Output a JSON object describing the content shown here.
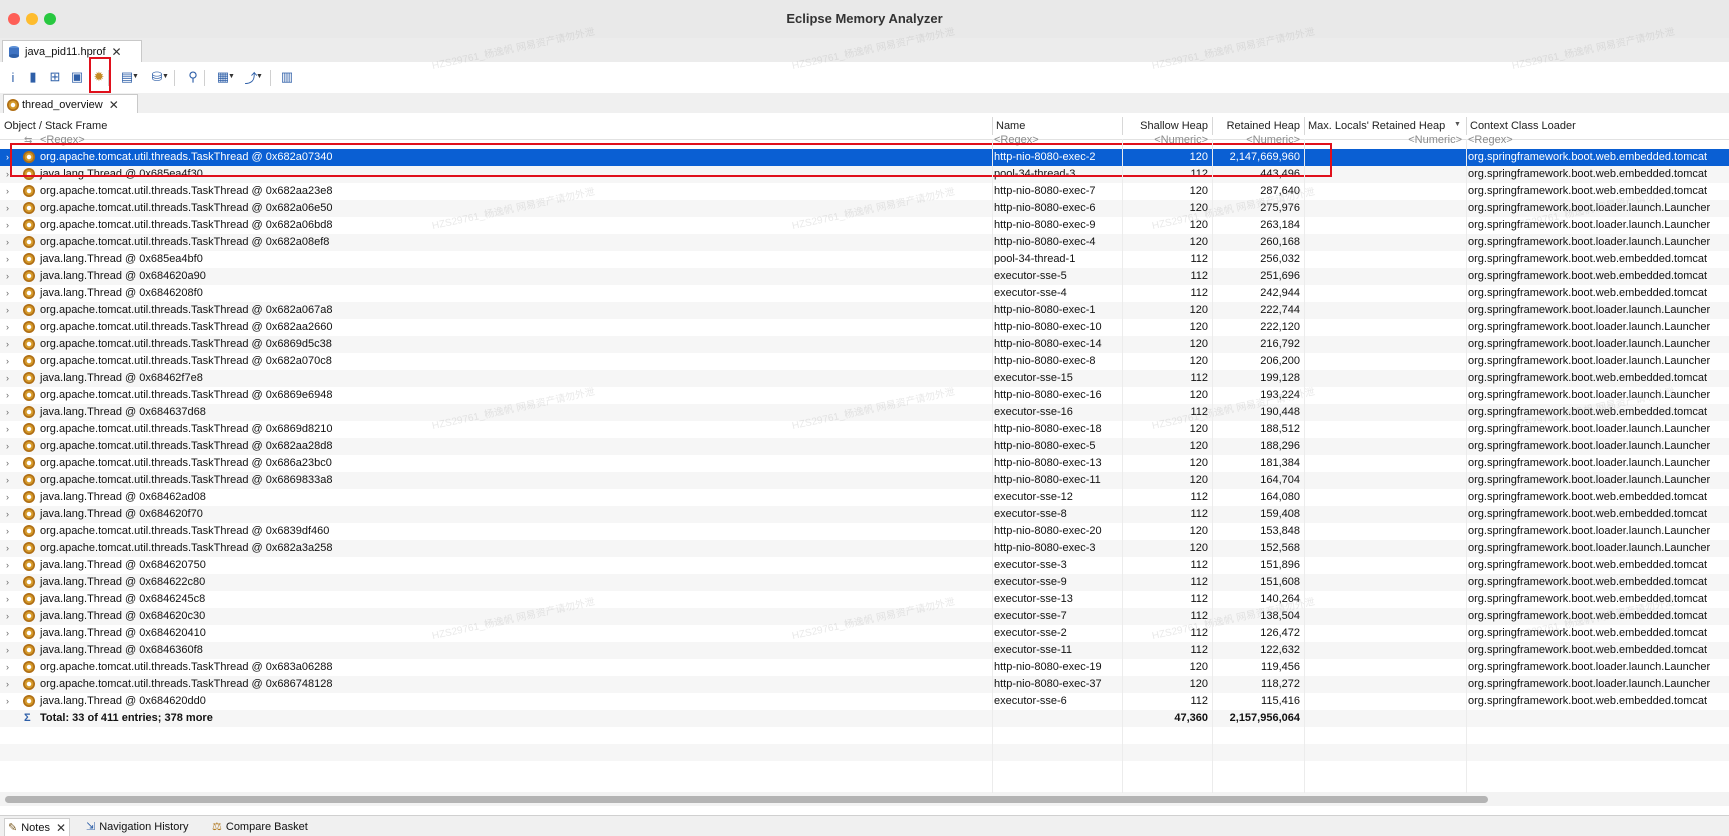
{
  "window": {
    "title": "Eclipse Memory Analyzer"
  },
  "editor_tab": {
    "label": "java_pid11.hprof",
    "close": "✕"
  },
  "toolbar": {
    "items": [
      {
        "name": "info-icon",
        "glyph": "i"
      },
      {
        "name": "histogram-icon",
        "glyph": "▮"
      },
      {
        "name": "dominator-tree-icon",
        "glyph": "⊞"
      },
      {
        "name": "oql-icon",
        "glyph": "▣"
      },
      {
        "name": "thread-overview-icon",
        "glyph": "✹"
      },
      {
        "name": "run-report-icon",
        "glyph": "▤"
      },
      {
        "name": "heap-dump-overview-icon",
        "glyph": "⛁"
      },
      {
        "name": "search-icon",
        "glyph": "⚲"
      },
      {
        "name": "query-browser-icon",
        "glyph": "▦"
      },
      {
        "name": "export-icon",
        "glyph": "⤴"
      },
      {
        "name": "leak-suspects-icon",
        "glyph": "▥"
      }
    ]
  },
  "result_tab": {
    "label": "thread_overview",
    "close": "✕"
  },
  "table": {
    "columns": {
      "object": "Object / Stack Frame",
      "name": "Name",
      "shallow": "Shallow Heap",
      "retained": "Retained Heap",
      "max_locals": "Max. Locals' Retained Heap",
      "loader": "Context Class Loader"
    },
    "filter": {
      "object": "<Regex>",
      "name": "<Regex>",
      "shallow": "<Numeric>",
      "retained": "<Numeric>",
      "max_locals": "<Numeric>",
      "loader": "<Regex>"
    },
    "rows": [
      {
        "object": "org.apache.tomcat.util.threads.TaskThread @ 0x682a07340",
        "name": "http-nio-8080-exec-2",
        "shallow": "120",
        "retained": "2,147,669,960",
        "loader": "org.springframework.boot.web.embedded.tomcat"
      },
      {
        "object": "java.lang.Thread @ 0x685ea4f30",
        "name": "pool-34-thread-3",
        "shallow": "112",
        "retained": "443,496",
        "loader": "org.springframework.boot.web.embedded.tomcat"
      },
      {
        "object": "org.apache.tomcat.util.threads.TaskThread @ 0x682aa23e8",
        "name": "http-nio-8080-exec-7",
        "shallow": "120",
        "retained": "287,640",
        "loader": "org.springframework.boot.web.embedded.tomcat"
      },
      {
        "object": "org.apache.tomcat.util.threads.TaskThread @ 0x682a06e50",
        "name": "http-nio-8080-exec-6",
        "shallow": "120",
        "retained": "275,976",
        "loader": "org.springframework.boot.loader.launch.Launcher"
      },
      {
        "object": "org.apache.tomcat.util.threads.TaskThread @ 0x682a06bd8",
        "name": "http-nio-8080-exec-9",
        "shallow": "120",
        "retained": "263,184",
        "loader": "org.springframework.boot.loader.launch.Launcher"
      },
      {
        "object": "org.apache.tomcat.util.threads.TaskThread @ 0x682a08ef8",
        "name": "http-nio-8080-exec-4",
        "shallow": "120",
        "retained": "260,168",
        "loader": "org.springframework.boot.loader.launch.Launcher"
      },
      {
        "object": "java.lang.Thread @ 0x685ea4bf0",
        "name": "pool-34-thread-1",
        "shallow": "112",
        "retained": "256,032",
        "loader": "org.springframework.boot.web.embedded.tomcat"
      },
      {
        "object": "java.lang.Thread @ 0x684620a90",
        "name": "executor-sse-5",
        "shallow": "112",
        "retained": "251,696",
        "loader": "org.springframework.boot.web.embedded.tomcat"
      },
      {
        "object": "java.lang.Thread @ 0x6846208f0",
        "name": "executor-sse-4",
        "shallow": "112",
        "retained": "242,944",
        "loader": "org.springframework.boot.web.embedded.tomcat"
      },
      {
        "object": "org.apache.tomcat.util.threads.TaskThread @ 0x682a067a8",
        "name": "http-nio-8080-exec-1",
        "shallow": "120",
        "retained": "222,744",
        "loader": "org.springframework.boot.loader.launch.Launcher"
      },
      {
        "object": "org.apache.tomcat.util.threads.TaskThread @ 0x682aa2660",
        "name": "http-nio-8080-exec-10",
        "shallow": "120",
        "retained": "222,120",
        "loader": "org.springframework.boot.loader.launch.Launcher"
      },
      {
        "object": "org.apache.tomcat.util.threads.TaskThread @ 0x6869d5c38",
        "name": "http-nio-8080-exec-14",
        "shallow": "120",
        "retained": "216,792",
        "loader": "org.springframework.boot.loader.launch.Launcher"
      },
      {
        "object": "org.apache.tomcat.util.threads.TaskThread @ 0x682a070c8",
        "name": "http-nio-8080-exec-8",
        "shallow": "120",
        "retained": "206,200",
        "loader": "org.springframework.boot.loader.launch.Launcher"
      },
      {
        "object": "java.lang.Thread @ 0x68462f7e8",
        "name": "executor-sse-15",
        "shallow": "112",
        "retained": "199,128",
        "loader": "org.springframework.boot.web.embedded.tomcat"
      },
      {
        "object": "org.apache.tomcat.util.threads.TaskThread @ 0x6869e6948",
        "name": "http-nio-8080-exec-16",
        "shallow": "120",
        "retained": "193,224",
        "loader": "org.springframework.boot.loader.launch.Launcher"
      },
      {
        "object": "java.lang.Thread @ 0x684637d68",
        "name": "executor-sse-16",
        "shallow": "112",
        "retained": "190,448",
        "loader": "org.springframework.boot.web.embedded.tomcat"
      },
      {
        "object": "org.apache.tomcat.util.threads.TaskThread @ 0x6869d8210",
        "name": "http-nio-8080-exec-18",
        "shallow": "120",
        "retained": "188,512",
        "loader": "org.springframework.boot.loader.launch.Launcher"
      },
      {
        "object": "org.apache.tomcat.util.threads.TaskThread @ 0x682aa28d8",
        "name": "http-nio-8080-exec-5",
        "shallow": "120",
        "retained": "188,296",
        "loader": "org.springframework.boot.loader.launch.Launcher"
      },
      {
        "object": "org.apache.tomcat.util.threads.TaskThread @ 0x686a23bc0",
        "name": "http-nio-8080-exec-13",
        "shallow": "120",
        "retained": "181,384",
        "loader": "org.springframework.boot.loader.launch.Launcher"
      },
      {
        "object": "org.apache.tomcat.util.threads.TaskThread @ 0x6869833a8",
        "name": "http-nio-8080-exec-11",
        "shallow": "120",
        "retained": "164,704",
        "loader": "org.springframework.boot.loader.launch.Launcher"
      },
      {
        "object": "java.lang.Thread @ 0x68462ad08",
        "name": "executor-sse-12",
        "shallow": "112",
        "retained": "164,080",
        "loader": "org.springframework.boot.web.embedded.tomcat"
      },
      {
        "object": "java.lang.Thread @ 0x684620f70",
        "name": "executor-sse-8",
        "shallow": "112",
        "retained": "159,408",
        "loader": "org.springframework.boot.web.embedded.tomcat"
      },
      {
        "object": "org.apache.tomcat.util.threads.TaskThread @ 0x6839df460",
        "name": "http-nio-8080-exec-20",
        "shallow": "120",
        "retained": "153,848",
        "loader": "org.springframework.boot.loader.launch.Launcher"
      },
      {
        "object": "org.apache.tomcat.util.threads.TaskThread @ 0x682a3a258",
        "name": "http-nio-8080-exec-3",
        "shallow": "120",
        "retained": "152,568",
        "loader": "org.springframework.boot.loader.launch.Launcher"
      },
      {
        "object": "java.lang.Thread @ 0x684620750",
        "name": "executor-sse-3",
        "shallow": "112",
        "retained": "151,896",
        "loader": "org.springframework.boot.web.embedded.tomcat"
      },
      {
        "object": "java.lang.Thread @ 0x684622c80",
        "name": "executor-sse-9",
        "shallow": "112",
        "retained": "151,608",
        "loader": "org.springframework.boot.web.embedded.tomcat"
      },
      {
        "object": "java.lang.Thread @ 0x6846245c8",
        "name": "executor-sse-13",
        "shallow": "112",
        "retained": "140,264",
        "loader": "org.springframework.boot.web.embedded.tomcat"
      },
      {
        "object": "java.lang.Thread @ 0x684620c30",
        "name": "executor-sse-7",
        "shallow": "112",
        "retained": "138,504",
        "loader": "org.springframework.boot.web.embedded.tomcat"
      },
      {
        "object": "java.lang.Thread @ 0x684620410",
        "name": "executor-sse-2",
        "shallow": "112",
        "retained": "126,472",
        "loader": "org.springframework.boot.web.embedded.tomcat"
      },
      {
        "object": "java.lang.Thread @ 0x6846360f8",
        "name": "executor-sse-11",
        "shallow": "112",
        "retained": "122,632",
        "loader": "org.springframework.boot.web.embedded.tomcat"
      },
      {
        "object": "org.apache.tomcat.util.threads.TaskThread @ 0x683a06288",
        "name": "http-nio-8080-exec-19",
        "shallow": "120",
        "retained": "119,456",
        "loader": "org.springframework.boot.loader.launch.Launcher"
      },
      {
        "object": "org.apache.tomcat.util.threads.TaskThread @ 0x686748128",
        "name": "http-nio-8080-exec-37",
        "shallow": "120",
        "retained": "118,272",
        "loader": "org.springframework.boot.loader.launch.Launcher"
      },
      {
        "object": "java.lang.Thread @ 0x684620dd0",
        "name": "executor-sse-6",
        "shallow": "112",
        "retained": "115,416",
        "loader": "org.springframework.boot.web.embedded.tomcat"
      }
    ],
    "total": {
      "label": "Total: 33 of 411 entries; 378 more",
      "shallow": "47,360",
      "retained": "2,157,956,064"
    }
  },
  "watermark": "HZS29761_杨逸帆 网易资产请勿外泄",
  "bottom_tabs": [
    {
      "label": "Notes",
      "icon": "notes-icon",
      "active": true
    },
    {
      "label": "Navigation History",
      "icon": "navigation-history-icon",
      "active": false
    },
    {
      "label": "Compare Basket",
      "icon": "compare-basket-icon",
      "active": false
    }
  ],
  "colors": {
    "selection": "#0a5fd3",
    "highlight": "#e0101c"
  }
}
